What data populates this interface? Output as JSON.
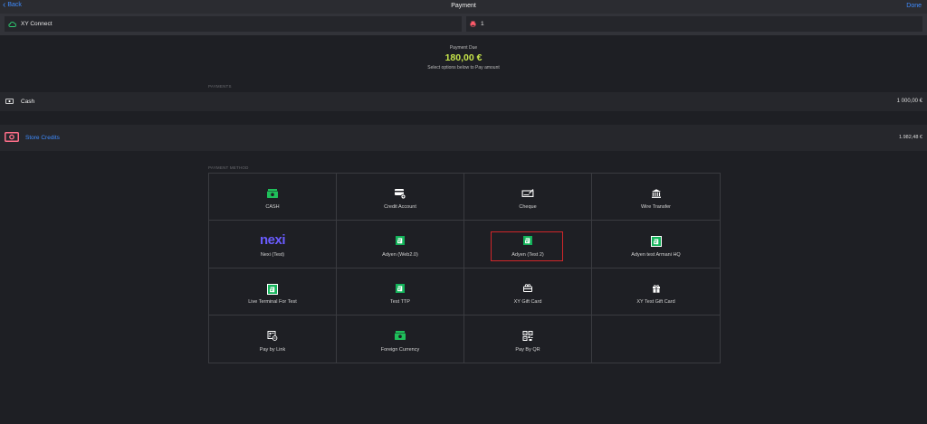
{
  "header": {
    "back_label": "Back",
    "title": "Payment",
    "done_label": "Done"
  },
  "chips": {
    "connection_label": "XY Connect",
    "quantity_label": "1"
  },
  "payment_due": {
    "label": "Payment Due",
    "amount": "180,00 €",
    "instruction": "Select options below to Pay amount"
  },
  "payments": {
    "section_label": "PAYMENTS",
    "items": [
      {
        "name": "Cash",
        "value": "1 000,00 €",
        "icon": "cash-icon"
      },
      {
        "name": "Store Credits",
        "value": "1.982,48 €",
        "icon": "store-credits-icon"
      }
    ]
  },
  "payment_methods": {
    "section_label": "PAYMENT METHOD",
    "items": [
      {
        "label": "CASH",
        "icon": "cash-note-icon"
      },
      {
        "label": "Credit Account",
        "icon": "credit-account-icon"
      },
      {
        "label": "Cheque",
        "icon": "cheque-icon"
      },
      {
        "label": "Wire Transfer",
        "icon": "bank-icon"
      },
      {
        "label": "Nexi (Test)",
        "icon": "nexi-logo",
        "logo_text": "nexi"
      },
      {
        "label": "Adyen (Web2.0)",
        "icon": "adyen-icon"
      },
      {
        "label": "Adyen (Test 2)",
        "icon": "adyen-icon",
        "highlighted": true
      },
      {
        "label": "Adyen test Armani HQ",
        "icon": "adyen-icon"
      },
      {
        "label": "Live Terminal For Test",
        "icon": "adyen-icon"
      },
      {
        "label": "Test TTP",
        "icon": "adyen-icon"
      },
      {
        "label": "XY Gift Card",
        "icon": "gift-card-icon"
      },
      {
        "label": "XY Test Gift Card",
        "icon": "gift-icon"
      },
      {
        "label": "Pay by Link",
        "icon": "pay-by-link-icon"
      },
      {
        "label": "Foreign Currency",
        "icon": "foreign-currency-icon"
      },
      {
        "label": "Pay By QR",
        "icon": "qr-code-icon"
      }
    ]
  },
  "colors": {
    "accent_blue": "#3f8cff",
    "amount_green": "#c7e54a",
    "adyen_green": "#13b35a",
    "highlight_red": "#d0262a",
    "nexi_purple": "#6a5cff"
  }
}
